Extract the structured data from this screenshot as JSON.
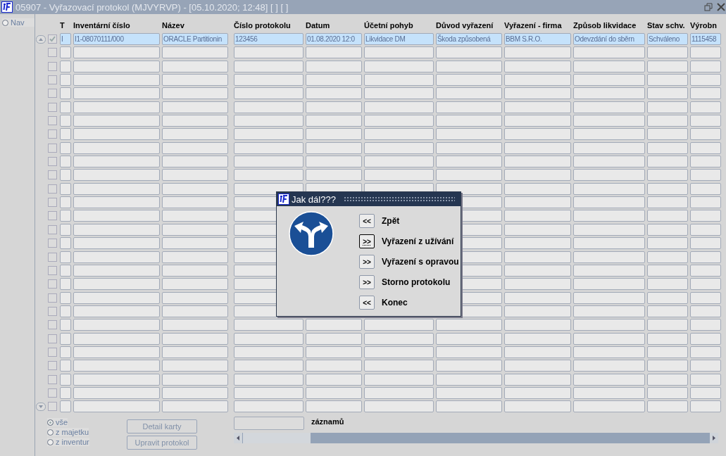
{
  "window": {
    "title": "05907 - Vyřazovací protokol (MJVYRVP) - [05.10.2020; 12:48]  [ ]  [ ]"
  },
  "nav": {
    "label": "Nav",
    "selected": false
  },
  "table": {
    "columns": [
      "T",
      "Inventární číslo",
      "Název",
      "Číslo protokolu",
      "Datum",
      "Účetní pohyb",
      "Důvod vyřazení",
      "Vyřazení - firma",
      "Způsob likvidace",
      "Stav schv.",
      "Výrobn"
    ],
    "rows": [
      {
        "checked": true,
        "selected": true,
        "cells": [
          "I",
          "I1-08070111/000",
          "ORACLE Partitionin",
          "123456",
          "01.08.2020 12:0",
          "Likvidace DM",
          "Škoda způsobená",
          "BBM S.R.O.",
          "Odevzdání do sběrn",
          "Schváleno",
          "1115458"
        ]
      },
      {
        "checked": false,
        "selected": false
      },
      {
        "checked": false,
        "selected": false
      },
      {
        "checked": false,
        "selected": false
      },
      {
        "checked": false,
        "selected": false
      },
      {
        "checked": false,
        "selected": false
      },
      {
        "checked": false,
        "selected": false
      },
      {
        "checked": false,
        "selected": false
      },
      {
        "checked": false,
        "selected": false
      },
      {
        "checked": false,
        "selected": false
      },
      {
        "checked": false,
        "selected": false
      },
      {
        "checked": false,
        "selected": false
      },
      {
        "checked": false,
        "selected": false
      },
      {
        "checked": false,
        "selected": false
      },
      {
        "checked": false,
        "selected": false
      },
      {
        "checked": false,
        "selected": false
      },
      {
        "checked": false,
        "selected": false
      },
      {
        "checked": false,
        "selected": false
      },
      {
        "checked": false,
        "selected": false
      },
      {
        "checked": false,
        "selected": false
      },
      {
        "checked": false,
        "selected": false
      },
      {
        "checked": false,
        "selected": false
      },
      {
        "checked": false,
        "selected": false
      },
      {
        "checked": false,
        "selected": false
      },
      {
        "checked": false,
        "selected": false
      },
      {
        "checked": false,
        "selected": false
      },
      {
        "checked": false,
        "selected": false
      },
      {
        "checked": false,
        "selected": false
      }
    ]
  },
  "filter": [
    {
      "label": "vše",
      "selected": true
    },
    {
      "label": "z majetku",
      "selected": false
    },
    {
      "label": "z inventur",
      "selected": false
    }
  ],
  "buttons": [
    {
      "label": "Detail karty",
      "disabled": true
    },
    {
      "label": "Upravit protokol",
      "disabled": true
    }
  ],
  "records_label": "záznamů",
  "dialog": {
    "title": "Jak dál???",
    "options": [
      {
        "key": "<<",
        "label": "Zpět",
        "focused": false
      },
      {
        "key": ">>",
        "label": "Vyřazení z užívání",
        "focused": true
      },
      {
        "key": ">>",
        "label": "Vyřazení s opravou",
        "focused": false
      },
      {
        "key": ">>",
        "label": "Storno protokolu",
        "focused": false
      },
      {
        "key": "<<",
        "label": "Konec",
        "focused": false
      }
    ]
  }
}
